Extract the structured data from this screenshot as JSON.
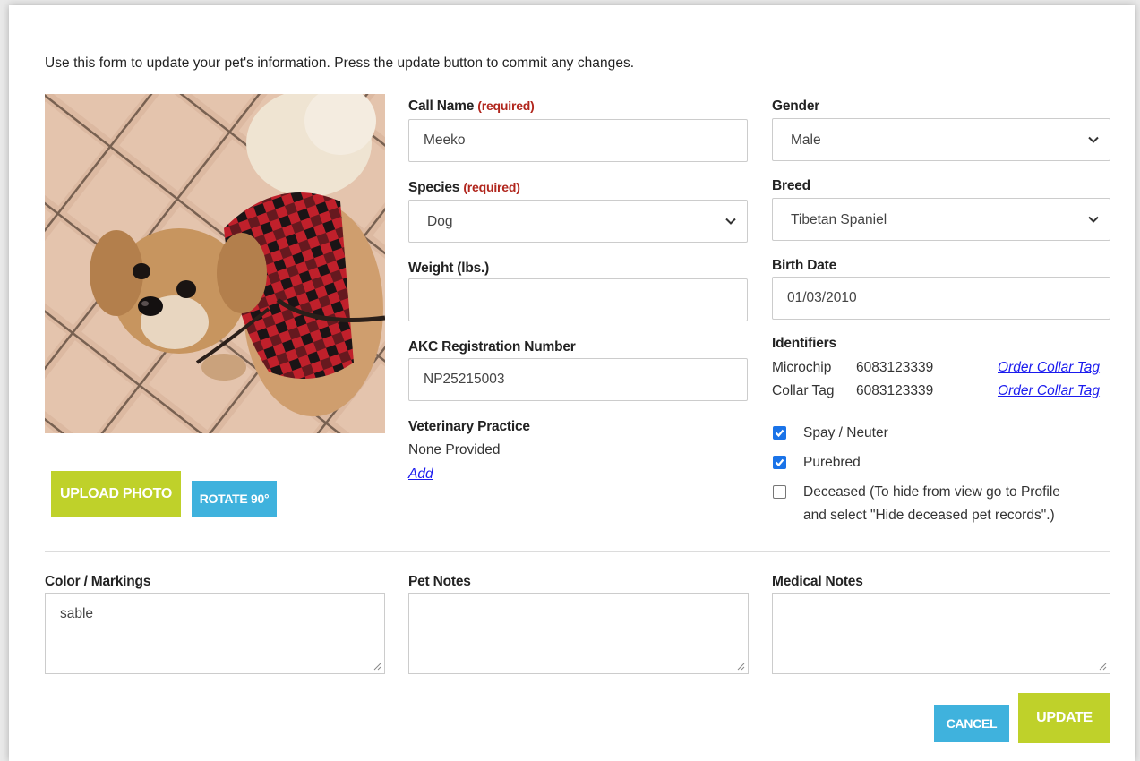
{
  "intro": "Use this form to update your pet's information.  Press the update button to commit any changes.",
  "photo": {
    "alt": "Photo of pet"
  },
  "buttons": {
    "upload_photo": "UPLOAD PHOTO",
    "rotate": "ROTATE 90°",
    "cancel": "CANCEL",
    "update": "UPDATE"
  },
  "fields": {
    "call_name": {
      "label": "Call Name",
      "required": "(required)",
      "value": "Meeko"
    },
    "species": {
      "label": "Species",
      "required": "(required)",
      "value": "Dog"
    },
    "weight": {
      "label": "Weight (lbs.)",
      "value": ""
    },
    "akc": {
      "label": "AKC Registration Number",
      "value": "NP25215003"
    },
    "vet": {
      "label": "Veterinary Practice",
      "value": "None Provided",
      "add_link": "Add"
    },
    "gender": {
      "label": "Gender",
      "value": "Male"
    },
    "breed": {
      "label": "Breed",
      "value": "Tibetan Spaniel"
    },
    "birth_date": {
      "label": "Birth Date",
      "value": "01/03/2010"
    }
  },
  "identifiers": {
    "label": "Identifiers",
    "items": [
      {
        "type": "Microchip",
        "number": "6083123339",
        "link": "Order Collar Tag"
      },
      {
        "type": "Collar Tag",
        "number": "6083123339",
        "link": "Order Collar Tag"
      }
    ]
  },
  "checkboxes": {
    "spay_neuter": {
      "label": "Spay / Neuter",
      "checked": true
    },
    "purebred": {
      "label": "Purebred",
      "checked": true
    },
    "deceased": {
      "label_line1": "Deceased (To hide from view go to Profile",
      "label_line2": "and select \"Hide deceased pet records\".)",
      "checked": false
    }
  },
  "notes": {
    "color_markings": {
      "label": "Color / Markings",
      "value": "sable"
    },
    "pet_notes": {
      "label": "Pet Notes",
      "value": ""
    },
    "medical_notes": {
      "label": "Medical Notes",
      "value": ""
    }
  },
  "colors": {
    "green": "#bfd12a",
    "blue": "#3fb2dd",
    "required": "#b1261d",
    "link": "#1a1aee",
    "checkbox": "#1a73e8"
  }
}
